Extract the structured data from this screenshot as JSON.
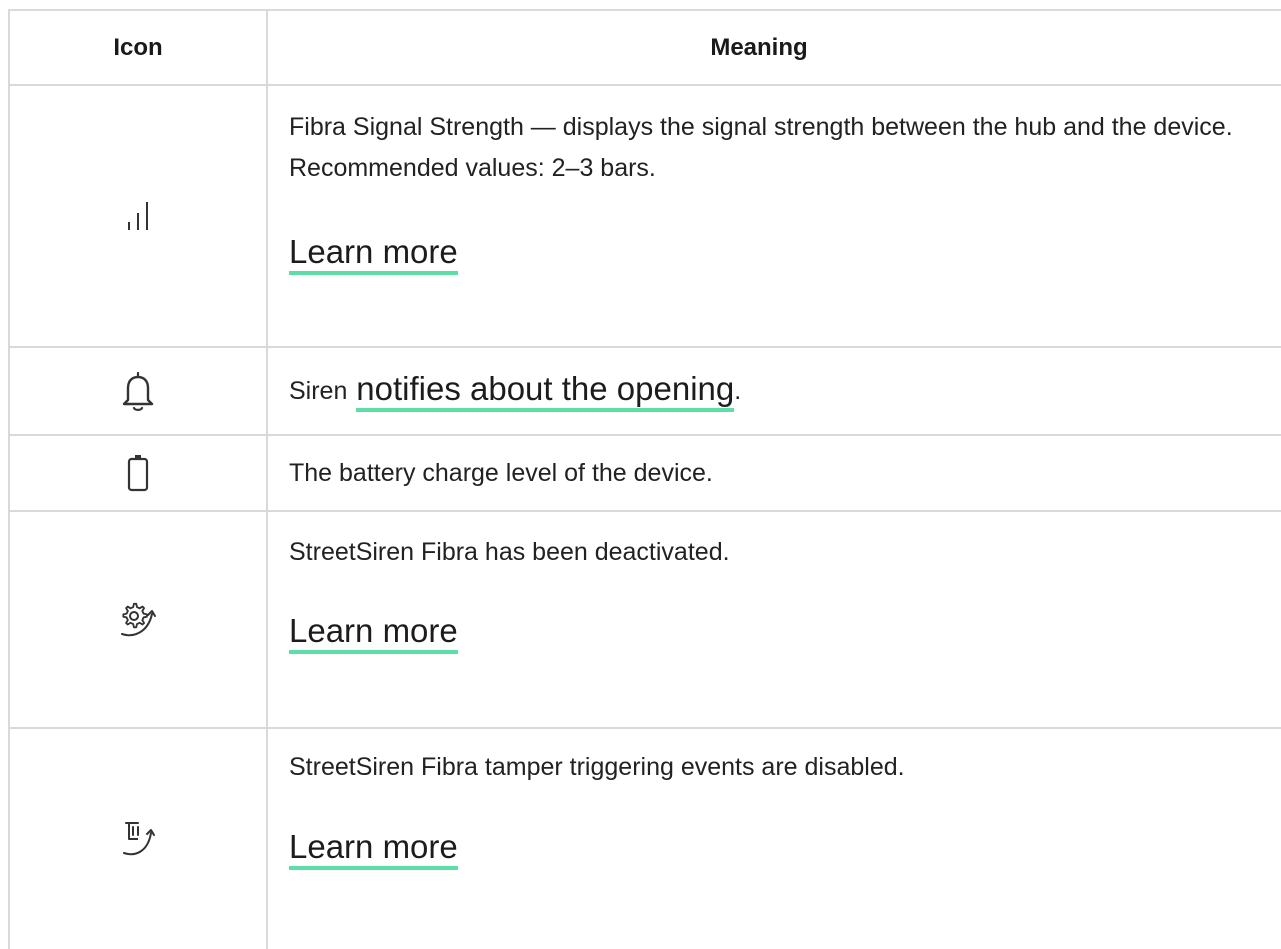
{
  "header": {
    "icon_col": "Icon",
    "meaning_col": "Meaning"
  },
  "rows": [
    {
      "icon": "signal-bars-icon",
      "text": "Fibra Signal Strength — displays the signal strength between the hub and the device. Recommended values: 2–3 bars.",
      "link": "Learn more"
    },
    {
      "icon": "bell-icon",
      "prefix": "Siren",
      "link": "notifies about the opening",
      "suffix": "."
    },
    {
      "icon": "battery-icon",
      "text": "The battery charge level of the device."
    },
    {
      "icon": "gear-deactivated-icon",
      "text": "StreetSiren Fibra has been deactivated.",
      "link": "Learn more"
    },
    {
      "icon": "tamper-disabled-icon",
      "text": "StreetSiren Fibra tamper triggering events are disabled.",
      "link": "Learn more"
    }
  ],
  "colors": {
    "accent_underline": "#5bdfa6",
    "border": "#d9d9d9"
  }
}
